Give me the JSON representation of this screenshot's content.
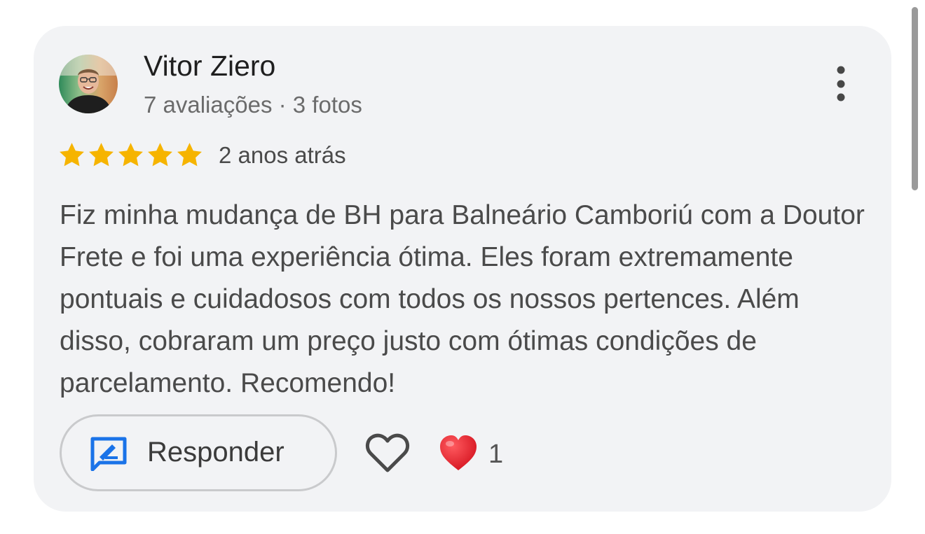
{
  "review": {
    "author_name": "Vitor Ziero",
    "author_meta": "7 avaliações · 3 fotos",
    "rating_stars": 5,
    "age": "2 anos atrás",
    "text": "Fiz minha mudança de BH para Balneário Camboriú com a Doutor Frete e foi uma experiência ótima. Eles foram extremamente pontuais e cuidadosos com todos os nossos pertences. Além disso, cobraram um preço justo com ótimas condições de parcelamento. Recomendo!"
  },
  "actions": {
    "reply_label": "Responder",
    "reaction_count": "1"
  },
  "icons": {
    "more": "more-vertical-icon",
    "reply": "reply-edit-icon",
    "like": "heart-outline-icon",
    "reaction": "red-heart-icon"
  },
  "colors": {
    "card_bg": "#f2f3f5",
    "star": "#f6b400",
    "reply_icon": "#1a73e8",
    "reaction_heart": "#e41b2b"
  }
}
